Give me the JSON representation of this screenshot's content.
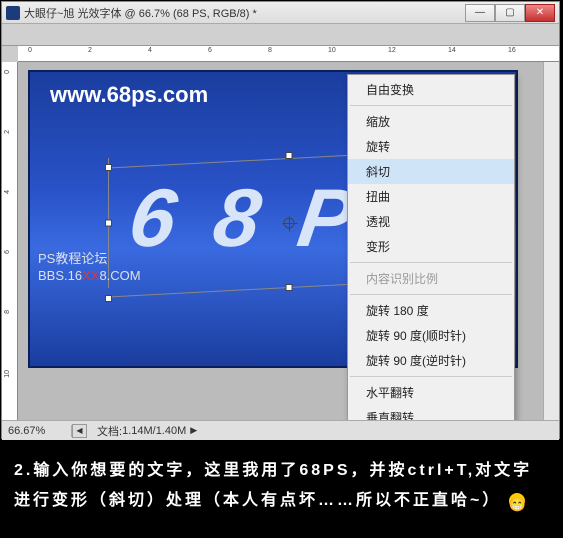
{
  "window": {
    "title": "大眼仔~旭 光效字体 @ 66.7% (68 PS, RGB/8) *",
    "minimize": "—",
    "maximize": "▢",
    "close": "✕"
  },
  "watermarks": {
    "url": "www.68ps.com",
    "forum": "PS教程论坛",
    "site_prefix": "BBS.16",
    "site_red": "XX",
    "site_suffix": "8.COM"
  },
  "canvas": {
    "text": "6 8 P"
  },
  "menu": {
    "free_transform": "自由变换",
    "scale": "缩放",
    "rotate": "旋转",
    "skew": "斜切",
    "distort": "扭曲",
    "perspective": "透视",
    "warp": "变形",
    "content_aware": "内容识别比例",
    "rotate180": "旋转 180 度",
    "rotate90cw": "旋转 90 度(顺时针)",
    "rotate90ccw": "旋转 90 度(逆时针)",
    "flip_h": "水平翻转",
    "flip_v": "垂直翻转"
  },
  "status": {
    "zoom": "66.67%",
    "doc_label": "文档:",
    "doc_size": "1.14M/1.40M"
  },
  "rulers": {
    "h0": "0",
    "h2": "2",
    "h4": "4",
    "h6": "6",
    "h8": "8",
    "h10": "10",
    "h12": "12",
    "h14": "14",
    "h16": "16",
    "v0": "0",
    "v2": "2",
    "v4": "4",
    "v6": "6",
    "v8": "8",
    "v10": "10"
  },
  "instruction": {
    "text": "2.输入你想要的文字，这里我用了68PS，并按ctrl+T,对文字进行变形（斜切）处理（本人有点坏……所以不正直哈~）"
  }
}
